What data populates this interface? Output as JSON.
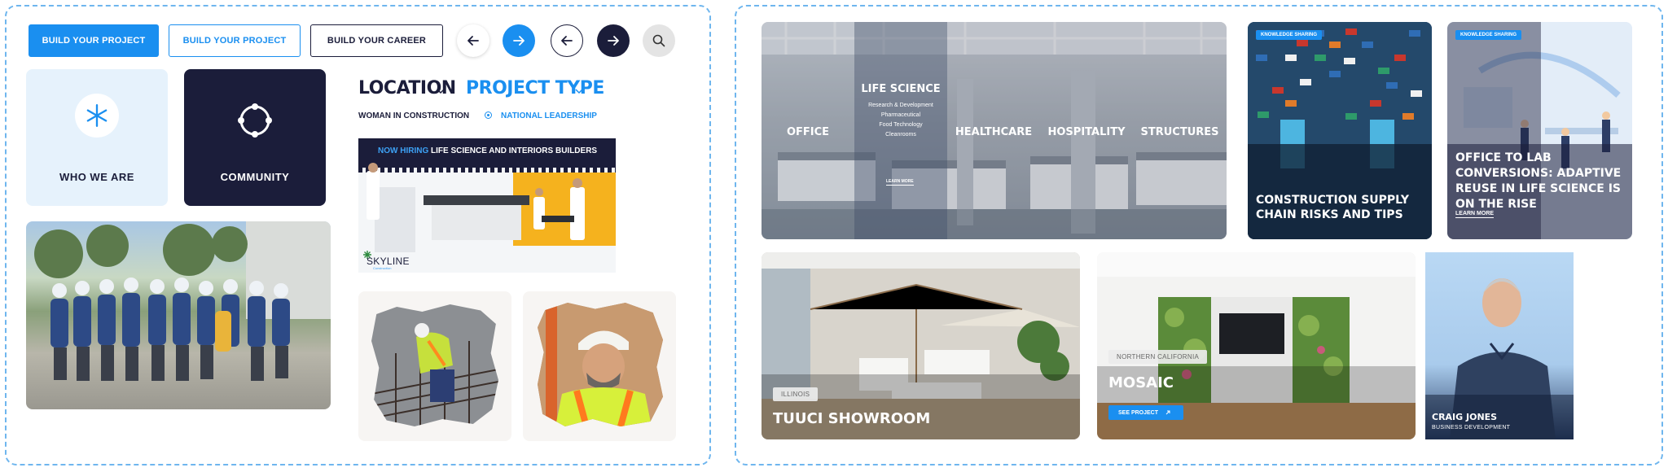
{
  "buttons": {
    "primary": "BUILD YOUR PROJECT",
    "outline": "BUILD YOUR PROJECT",
    "career": "BUILD YOUR CAREER"
  },
  "icons": {
    "arrow_left": "arrow-left-icon",
    "arrow_right": "arrow-right-icon",
    "search": "search-icon",
    "snowflake": "asterisk-icon",
    "community": "community-ring-icon"
  },
  "colors": {
    "accent": "#1a8ff0",
    "navy": "#1b1d3a",
    "light_tile": "#e6f2fc",
    "yellow": "#f5b21e"
  },
  "tiles": {
    "who_we_are": "WHO WE ARE",
    "community": "COMMUNITY"
  },
  "filters": {
    "location": "LOCATION",
    "project_type": "PROJECT TYPE",
    "option_1": "WOMAN IN CONSTRUCTION",
    "option_2": "NATIONAL LEADERSHIP"
  },
  "hiring_banner": {
    "highlight": "NOW HIRING",
    "rest": "LIFE SCIENCE AND INTERIORS BUILDERS",
    "logo": "SKYLINE",
    "logo_sub": "Construction"
  },
  "sectors": {
    "items": [
      "OFFICE",
      "LIFE SCIENCE",
      "HEALTHCARE",
      "HOSPITALITY",
      "STRUCTURES"
    ],
    "life_science_sub": [
      "Research & Development",
      "Pharmaceutical",
      "Food Technology",
      "Cleanrooms"
    ],
    "learn_more": "LEARN MORE"
  },
  "articles": {
    "supply": {
      "tag": "KNOWLEDGE SHARING",
      "title": "CONSTRUCTION SUPPLY CHAIN RISKS AND TIPS"
    },
    "lab": {
      "tag": "KNOWLEDGE SHARING",
      "title": "OFFICE TO LAB CONVERSIONS: ADAPTIVE REUSE IN LIFE SCIENCE IS ON THE RISE",
      "learn_more": "LEARN MORE"
    }
  },
  "projects": {
    "tuuci": {
      "region": "ILLINOIS",
      "title": "TUUCI SHOWROOM"
    },
    "mosaic": {
      "region": "NORTHERN CALIFORNIA",
      "title": "MOSAIC",
      "cta": "SEE PROJECT"
    }
  },
  "person": {
    "name": "CRAIG JONES",
    "role": "BUSINESS DEVELOPMENT"
  }
}
